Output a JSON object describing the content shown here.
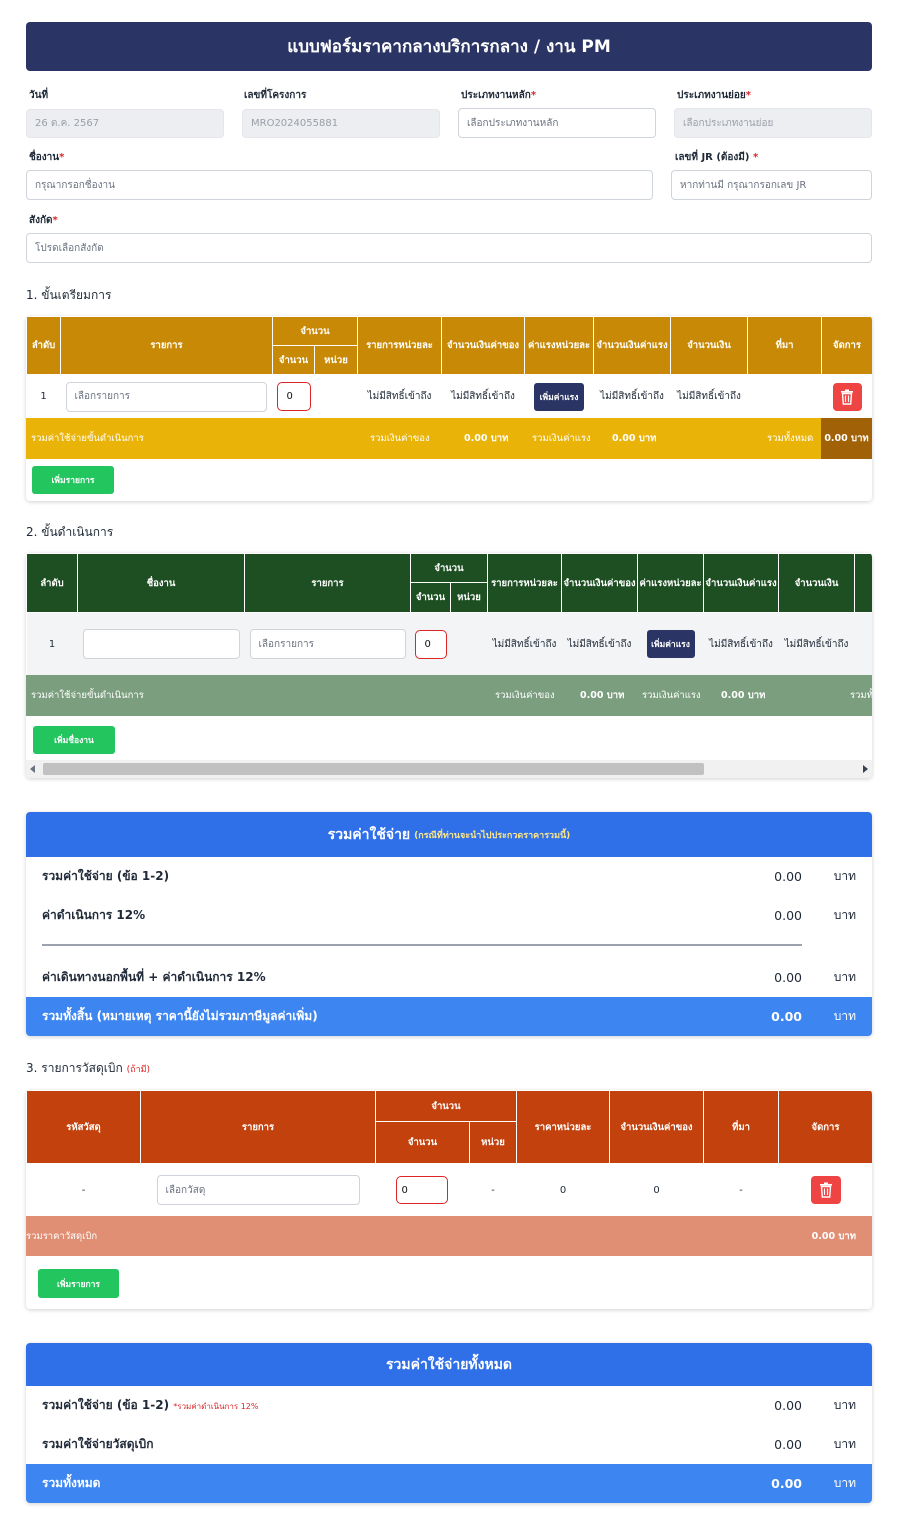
{
  "title": "แบบฟอร์มราคากลางบริการกลาง / งาน PM",
  "form": {
    "date_label": "วันที่",
    "date_value": "26 ต.ค. 2567",
    "project_no_label": "เลขที่โครงการ",
    "project_no_value": "MRO2024055881",
    "main_type_label": "ประเภทงานหลัก",
    "main_type_placeholder": "เลือกประเภทงานหลัก",
    "sub_type_label": "ประเภทงานย่อย",
    "sub_type_placeholder": "เลือกประเภทงานย่อย",
    "job_name_label": "ชื่องาน",
    "job_name_placeholder": "กรุณากรอกชื่องาน",
    "jr_label": "เลขที่ JR (ต้องมี)",
    "jr_placeholder": "หากท่านมี กรุณากรอกเลข JR",
    "affiliation_label": "สังกัด",
    "affiliation_placeholder": "โปรดเลือกสังกัด",
    "required_mark": "*"
  },
  "section1": {
    "title": "1. ขั้นเตรียมการ",
    "headers": {
      "no": "ลำดับ",
      "item": "รายการ",
      "qty_group": "จำนวน",
      "qty": "จำนวน",
      "unit": "หน่วย",
      "item_per_unit": "รายการหน่วยละ",
      "material_amount": "จำนวนเงินค่าของ",
      "labor_per_unit": "ค่าแรงหน่วยละ",
      "labor_amount": "จำนวนเงินค่าแรง",
      "total_amount": "จำนวนเงิน",
      "source": "ที่มา",
      "manage": "จัดการ"
    },
    "row": {
      "no": "1",
      "item_placeholder": "เลือกรายการ",
      "qty": "0",
      "item_per_unit": "ไม่มีสิทธิ์เข้าถึง",
      "material_amount": "ไม่มีสิทธิ์เข้าถึง",
      "add_labor": "เพิ่มค่าแรง",
      "labor_amount": "ไม่มีสิทธิ์เข้าถึง",
      "total_amount": "ไม่มีสิทธิ์เข้าถึง"
    },
    "summary": {
      "label": "รวมค่าใช้จ่ายขั้นดำเนินการ",
      "material_label": "รวมเงินค่าของ",
      "material_value": "0.00 บาท",
      "labor_label": "รวมเงินค่าแรง",
      "labor_value": "0.00 บาท",
      "total_label": "รวมทั้งหมด",
      "total_value": "0.00 บาท"
    },
    "add_button": "เพิ่มรายการ"
  },
  "section2": {
    "title": "2. ขั้นดำเนินการ",
    "headers": {
      "no": "ลำดับ",
      "job_name": "ชื่องาน",
      "item": "รายการ",
      "qty_group": "จำนวน",
      "qty": "จำนวน",
      "unit": "หน่วย",
      "item_per_unit": "รายการหน่วยละ",
      "material_amount": "จำนวนเงินค่าของ",
      "labor_per_unit": "ค่าแรงหน่วยละ",
      "labor_amount": "จำนวนเงินค่าแรง",
      "total_amount": "จำนวนเงิน"
    },
    "row": {
      "no": "1",
      "item_placeholder": "เลือกรายการ",
      "qty": "0",
      "item_per_unit": "ไม่มีสิทธิ์เข้าถึง",
      "material_amount": "ไม่มีสิทธิ์เข้าถึง",
      "add_labor": "เพิ่มค่าแรง",
      "labor_amount": "ไม่มีสิทธิ์เข้าถึง",
      "total_amount": "ไม่มีสิทธิ์เข้าถึง"
    },
    "summary": {
      "label": "รวมค่าใช้จ่ายขั้นดำเนินการ",
      "material_label": "รวมเงินค่าของ",
      "material_value": "0.00 บาท",
      "labor_label": "รวมเงินค่าแรง",
      "labor_value": "0.00 บาท",
      "total_label_partial": "รวมทั้"
    },
    "add_button": "เพิ่มชื่องาน"
  },
  "expense_summary": {
    "title": "รวมค่าใช้จ่าย",
    "subtitle": "(กรณีที่ท่านจะนำไปประกวดราคารวมนี้)",
    "rows": [
      {
        "label": "รวมค่าใช้จ่าย (ข้อ 1-2)",
        "value": "0.00",
        "unit": "บาท"
      },
      {
        "label": "ค่าดำเนินการ 12%",
        "value": "0.00",
        "unit": "บาท"
      },
      {
        "label": "ค่าเดินทางนอกพื้นที่ + ค่าดำเนินการ 12%",
        "value": "0.00",
        "unit": "บาท"
      }
    ],
    "grand": {
      "label": "รวมทั้งสิ้น (หมายเหตุ ราคานี้ยังไม่รวมภาษีมูลค่าเพิ่ม)",
      "value": "0.00",
      "unit": "บาท"
    }
  },
  "section3": {
    "title": "3. รายการวัสดุเบิก",
    "title_note": "(ถ้ามี)",
    "headers": {
      "code": "รหัสวัสดุ",
      "item": "รายการ",
      "qty_group": "จำนวน",
      "qty": "จำนวน",
      "unit": "หน่วย",
      "price_per_unit": "ราคาหน่วยละ",
      "material_amount": "จำนวนเงินค่าของ",
      "source": "ที่มา",
      "manage": "จัดการ"
    },
    "row": {
      "code": "-",
      "item_placeholder": "เลือกวัสดุ",
      "qty": "0",
      "unit": "-",
      "price_per_unit": "0",
      "material_amount": "0",
      "source": "-"
    },
    "summary": {
      "label": "รวมราคาวัสดุเบิก",
      "value": "0.00 บาท"
    },
    "add_button": "เพิ่มรายการ"
  },
  "grand_summary": {
    "title": "รวมค่าใช้จ่ายทั้งหมด",
    "rows": [
      {
        "label": "รวมค่าใช้จ่าย (ข้อ 1-2)",
        "note": "*รวมค่าดำเนินการ 12%",
        "value": "0.00",
        "unit": "บาท"
      },
      {
        "label": "รวมค่าใช้จ่ายวัสดุเบิก",
        "value": "0.00",
        "unit": "บาท"
      }
    ],
    "total": {
      "label": "รวมทั้งหมด",
      "value": "0.00",
      "unit": "บาท"
    }
  },
  "colors": {
    "header_navy": "#2b3565",
    "section1_header": "#c88a06",
    "section1_summary": "#e9b308",
    "section1_total_cell": "#a16207",
    "section2_header": "#1d4f23",
    "section2_summary": "#7a9e7e",
    "section3_header": "#c2410c",
    "section3_summary": "#e08f74",
    "summary_blue": "#2f6fe8",
    "green_button": "#22c55e",
    "delete_red": "#ef4444"
  },
  "icons": [
    "trash-icon",
    "scroll-left-icon",
    "scroll-right-icon"
  ]
}
